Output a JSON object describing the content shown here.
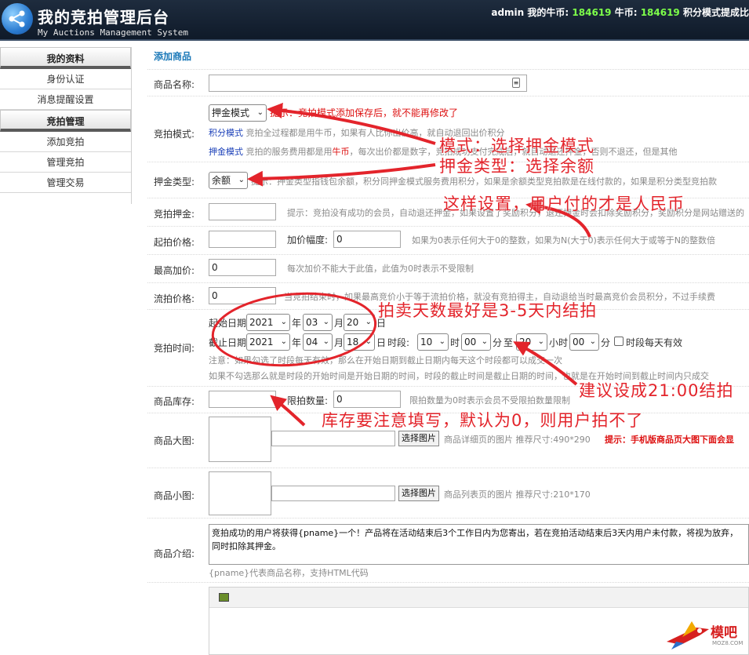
{
  "header": {
    "title": "我的竞拍管理后台",
    "subtitle": "My Auctions Management System",
    "user": "admin",
    "niubi_label_1": "我的牛币:",
    "niubi_value_1": "184619",
    "niubi_label_2": "牛币:",
    "niubi_value_2": "184619",
    "tail": "积分模式提成比"
  },
  "sidebar": {
    "section1": "我的资料",
    "items1": [
      "身份认证",
      "消息提醒设置"
    ],
    "section2": "竞拍管理",
    "items2": [
      "添加竞拍",
      "管理竞拍",
      "管理交易"
    ]
  },
  "form": {
    "section_title": "添加商品",
    "name_label": "商品名称:",
    "mode_label": "竞拍模式:",
    "mode_value": "押金模式",
    "mode_tip": "提示：竞拍模式添加保存后，就不能再修改了",
    "mode_desc1_key": "积分模式",
    "mode_desc1": "竞拍全过程都是用牛币，如果有人比你出价高，就自动退回出价积分",
    "mode_desc2_key": "押金模式",
    "mode_desc2_a": "竞拍的服务费用都是用",
    "mode_desc2_b": "牛币",
    "mode_desc2_c": "，每次出价都是数字，竞拍成功支付完成后，就自动退还押金，否则不退还，但是其他",
    "deposit_type_label": "押金类型:",
    "deposit_type_value": "余额",
    "deposit_type_hint": "提示：押金类型指钱包余额，积分同押金模式服务费用积分，如果是余额类型竞拍款是在线付款的，如果是积分类型竞拍款",
    "deposit_label": "竞拍押金:",
    "deposit_hint": "提示：竞拍没有成功的会员，自动退还押金，如果设置了奖励积分，退还押金时会扣除奖励积分，奖励积分是网站赠送的",
    "start_price_label": "起拍价格:",
    "increment_label": "加价幅度:",
    "increment_value": "0",
    "increment_hint": "如果为0表示任何大于0的整数，如果为N(大于0)表示任何大于或等于N的整数倍",
    "max_inc_label": "最高加价:",
    "max_inc_value": "0",
    "max_inc_hint": "每次加价不能大于此值，此值为0时表示不受限制",
    "reserve_label": "流拍价格:",
    "reserve_value": "0",
    "reserve_hint": "当竞拍结束时，如果最高竞价小于等于流拍价格，就没有竞拍得主，自动退给当时最高竞价会员积分，不过手续费",
    "time_label": "竞拍时间:",
    "start_date_label": "起始日期",
    "start_year": "2021",
    "start_month": "03",
    "start_day": "20",
    "end_date_label": "截止日期",
    "end_year": "2021",
    "end_month": "04",
    "end_day": "18",
    "unit_year": "年",
    "unit_month": "月",
    "unit_day": "日",
    "period_label": "时段:",
    "period_start_h": "10",
    "period_start_m": "00",
    "period_to": "至",
    "period_end_h": "20",
    "period_end_m": "00",
    "unit_hour": "时",
    "unit_hour2": "小时",
    "unit_min": "分",
    "daily_label": "时段每天有效",
    "time_note1": "注意：如果勾选了时段每天有效，那么在开始日期到截止日期内每天这个时段都可以成交一次",
    "time_note2": "如果不勾选那么就是时段的开始时间是开始日期的时间，时段的截止时间是截止日期的时间，也就是在开始时间到截止时间内只成交",
    "stock_label": "商品库存:",
    "limit_label": "限拍数量:",
    "limit_value": "0",
    "limit_hint": "限拍数量为0时表示会员不受限拍数量限制",
    "big_img_label": "商品大图:",
    "choose_btn": "选择图片",
    "big_img_hint": "商品详细页的图片 推荐尺寸:490*290",
    "big_img_tip": "提示：手机版商品页大图下面会显",
    "small_img_label": "商品小图:",
    "small_img_hint": "商品列表页的图片 推荐尺寸:210*170",
    "intro_label": "商品介绍:",
    "intro_text": "竞拍成功的用户将获得{pname}一个！产品将在活动结束后3个工作日内为您寄出，若在竞拍活动结束后3天内用户未付款，将视为放弃，同时扣除其押金。",
    "intro_hint": "{pname}代表商品名称，支持HTML代码"
  },
  "annotations": {
    "a1": "模式：选择押金模式",
    "a2": "押金类型：选择余额",
    "a3": "这样设置，用户付的才是人民币",
    "a4": "拍卖天数最好是3-5天内结拍",
    "a5": "建议设成21:00结拍",
    "a6": "库存要注意填写，默认为0，则用户拍不了"
  },
  "watermark": {
    "text": "模吧",
    "sub": "MOZ8.COM"
  },
  "colors": {
    "annotation": "#e3242b",
    "header_bg": "#1e2c3e",
    "accent_green": "#7dff4a",
    "link_blue": "#1a78b8"
  }
}
